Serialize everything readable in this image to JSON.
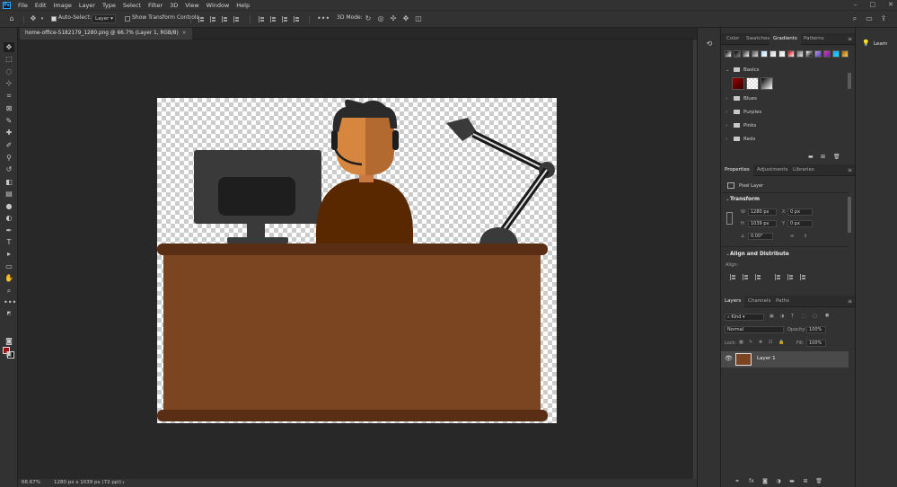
{
  "menubar": {
    "items": [
      "File",
      "Edit",
      "Image",
      "Layer",
      "Type",
      "Select",
      "Filter",
      "3D",
      "View",
      "Window",
      "Help"
    ]
  },
  "options_bar": {
    "auto_select_label": "Auto-Select:",
    "auto_select_target": "Layer",
    "show_transform_label": "Show Transform Controls",
    "mode_3d_label": "3D Mode:"
  },
  "document": {
    "tab_title": "home-office-5182179_1280.png @ 66.7% (Layer 1, RGB/8)",
    "tab_close": "×"
  },
  "status_bar": {
    "zoom": "66.67%",
    "doc_info": "1280 px x 1039 px (72 ppi)",
    "arrow": "›"
  },
  "swatch_panel": {
    "tabs": [
      "Color",
      "Swatches",
      "Gradients",
      "Patterns"
    ],
    "active_tab": "Gradients",
    "groups": [
      "Basics",
      "Blues",
      "Purples",
      "Pinks",
      "Reds"
    ]
  },
  "properties_panel": {
    "tabs": [
      "Properties",
      "Adjustments",
      "Libraries"
    ],
    "active_tab": "Properties",
    "layer_kind": "Pixel Layer",
    "transform_title": "Transform",
    "w_label": "W",
    "w_value": "1280 px",
    "h_label": "H",
    "h_value": "1039 px",
    "x_label": "X",
    "x_value": "0 px",
    "y_label": "Y",
    "y_value": "0 px",
    "angle_value": "0.00°",
    "align_title": "Align and Distribute",
    "align_label": "Align:"
  },
  "layers_panel": {
    "tabs": [
      "Layers",
      "Channels",
      "Paths"
    ],
    "active_tab": "Layers",
    "filter_kind": "Kind",
    "blend_mode": "Normal",
    "opacity_label": "Opacity:",
    "opacity_value": "100%",
    "lock_label": "Lock:",
    "fill_label": "Fill:",
    "fill_value": "100%",
    "layers": [
      {
        "name": "Layer 1"
      }
    ]
  },
  "learn": {
    "label": "Learn"
  },
  "colors": {
    "foreground": "#a01010",
    "background": "#000000",
    "desk": "#7a4520",
    "desk_edge": "#5a2e14",
    "monitor": "#3a3a3a",
    "shirt": "#5a2800",
    "skin": "#c87840"
  }
}
